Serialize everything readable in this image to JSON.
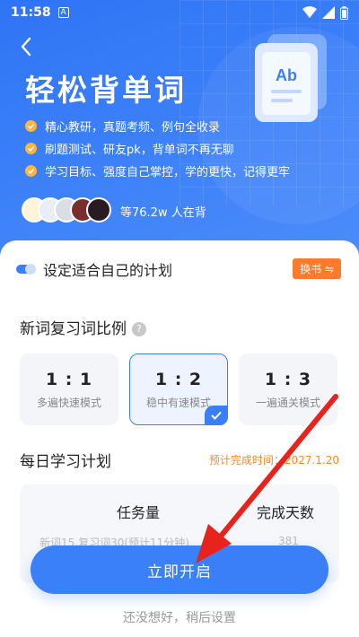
{
  "status": {
    "time": "11:58",
    "notif_icon": "A"
  },
  "hero": {
    "title": "轻松背单词",
    "bullets": [
      "精心教研，真题考频、例句全收录",
      "刷题测试、研友pk，背单词不再无聊",
      "学习目标、强度自己掌控，学的更快，记得更牢"
    ],
    "learners": "等76.2w 人在背",
    "book_label": "Ab"
  },
  "plan": {
    "title": "设定适合自己的计划",
    "swap_book": "换书 ⇋"
  },
  "ratio_section": {
    "title": "新词复习词比例",
    "help": "?",
    "options": [
      {
        "ratio": "1 : 1",
        "label": "多遍快速模式"
      },
      {
        "ratio": "1 : 2",
        "label": "稳中有速模式"
      },
      {
        "ratio": "1 : 3",
        "label": "一遍通关模式"
      }
    ]
  },
  "daily": {
    "title": "每日学习计划",
    "finish_time": "预计完成时间：2027.1.20",
    "headers": {
      "task": "任务量",
      "days": "完成天数"
    },
    "row": {
      "task": "新词15,复习词30(预计11分钟)",
      "days": "381"
    }
  },
  "actions": {
    "start": "立即开启",
    "later": "还没想好，稍后设置"
  },
  "colors": {
    "primary": "#3b7ff8",
    "accent": "#ff7a2b",
    "check": "#ffb43a",
    "arrow": "#e8231c"
  }
}
